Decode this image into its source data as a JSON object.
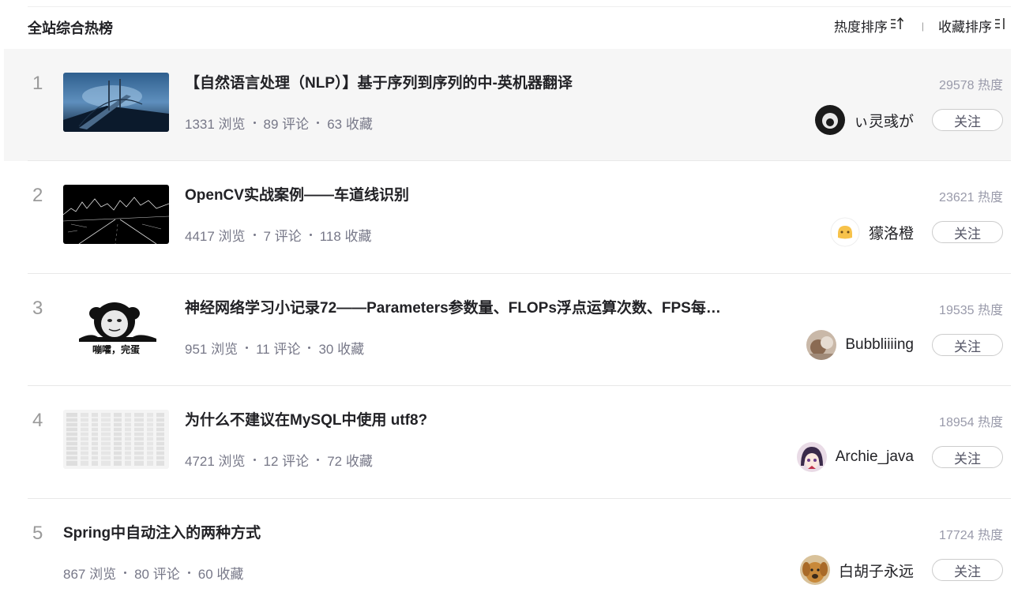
{
  "header": {
    "title": "全站综合热榜",
    "sort_heat": "热度排序",
    "sort_heat_icon": "sort-up-arrow-icon",
    "separator": "|",
    "sort_fav": "收藏排序",
    "sort_fav_icon": "sort-bars-icon"
  },
  "items": [
    {
      "rank": "1",
      "title": "【自然语言处理（NLP）】基于序列到序列的中-英机器翻译",
      "views": "1331 浏览",
      "comments": "89 评论",
      "favorites": "63 收藏",
      "heat": "29578 热度",
      "author": "ぃ灵彧が",
      "follow": "关注"
    },
    {
      "rank": "2",
      "title": "OpenCV实战案例——车道线识别",
      "views": "4417 浏览",
      "comments": "7 评论",
      "favorites": "118 收藏",
      "heat": "23621 热度",
      "author": "獴洛橙",
      "follow": "关注"
    },
    {
      "rank": "3",
      "title": "神经网络学习小记录72——Parameters参数量、FLOPs浮点运算次数、FPS每…",
      "views": "951 浏览",
      "comments": "11 评论",
      "favorites": "30 收藏",
      "heat": "19535 热度",
      "author": "Bubbliiiing",
      "follow": "关注",
      "thumb_caption": "嘣嚯，完蛋"
    },
    {
      "rank": "4",
      "title": "为什么不建议在MySQL中使用 utf8?",
      "views": "4721 浏览",
      "comments": "12 评论",
      "favorites": "72 收藏",
      "heat": "18954 热度",
      "author": "Archie_java",
      "follow": "关注"
    },
    {
      "rank": "5",
      "title": "Spring中自动注入的两种方式",
      "views": "867 浏览",
      "comments": "80 评论",
      "favorites": "60 收藏",
      "heat": "17724 热度",
      "author": "白胡子永远",
      "follow": "关注"
    }
  ]
}
